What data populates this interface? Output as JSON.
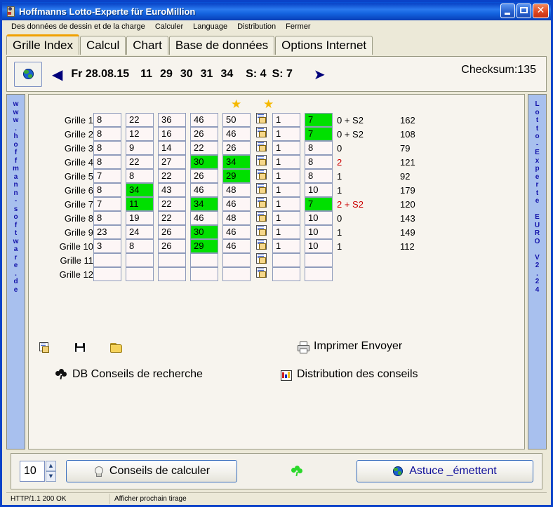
{
  "window": {
    "title": "Hoffmanns Lotto-Experte  für EuroMillion",
    "icon": "app-icon",
    "minimize": "_",
    "maximize": "□",
    "close": "✕"
  },
  "menu": {
    "items": [
      "Des données de dessin et de la charge",
      "Calculer",
      "Language",
      "Distribution",
      "Fermer"
    ]
  },
  "tabs": [
    {
      "label": "Grille Index",
      "active": true
    },
    {
      "label": "Calcul",
      "active": false
    },
    {
      "label": "Chart",
      "active": false
    },
    {
      "label": "Base de données",
      "active": false
    },
    {
      "label": "Options Internet",
      "active": false
    }
  ],
  "drawbar": {
    "globe_icon": "globe-icon",
    "prev_arrow": "◀",
    "next_arrow": "➤",
    "date": "Fr 28.08.15",
    "numbers": [
      "11",
      "29",
      "30",
      "31",
      "34"
    ],
    "star_labels": [
      "S: 4",
      "S: 7"
    ],
    "checksum": "Checksum:135"
  },
  "left_banner": "www.hoffmann-software.de",
  "right_banner": "Lotto-Experte EURO V2.24",
  "grid": {
    "star_markers": [
      "★",
      "★"
    ],
    "rows": [
      {
        "label": "Grille 1",
        "nums": [
          "8",
          "22",
          "36",
          "46",
          "50"
        ],
        "hits": [
          false,
          false,
          false,
          false,
          false
        ],
        "stars": [
          "1",
          "7"
        ],
        "star_hits": [
          false,
          true
        ],
        "result": "0 + S2",
        "result_warn": false,
        "sum": "162"
      },
      {
        "label": "Grille 2",
        "nums": [
          "8",
          "12",
          "16",
          "26",
          "46"
        ],
        "hits": [
          false,
          false,
          false,
          false,
          false
        ],
        "stars": [
          "1",
          "7"
        ],
        "star_hits": [
          false,
          true
        ],
        "result": "0 + S2",
        "result_warn": false,
        "sum": "108"
      },
      {
        "label": "Grille 3",
        "nums": [
          "8",
          "9",
          "14",
          "22",
          "26"
        ],
        "hits": [
          false,
          false,
          false,
          false,
          false
        ],
        "stars": [
          "1",
          "8"
        ],
        "star_hits": [
          false,
          false
        ],
        "result": "0",
        "result_warn": false,
        "sum": "79"
      },
      {
        "label": "Grille 4",
        "nums": [
          "8",
          "22",
          "27",
          "30",
          "34"
        ],
        "hits": [
          false,
          false,
          false,
          true,
          true
        ],
        "stars": [
          "1",
          "8"
        ],
        "star_hits": [
          false,
          false
        ],
        "result": "2",
        "result_warn": true,
        "sum": "121"
      },
      {
        "label": "Grille 5",
        "nums": [
          "7",
          "8",
          "22",
          "26",
          "29"
        ],
        "hits": [
          false,
          false,
          false,
          false,
          true
        ],
        "stars": [
          "1",
          "8"
        ],
        "star_hits": [
          false,
          false
        ],
        "result": "1",
        "result_warn": false,
        "sum": "92"
      },
      {
        "label": "Grille 6",
        "nums": [
          "8",
          "34",
          "43",
          "46",
          "48"
        ],
        "hits": [
          false,
          true,
          false,
          false,
          false
        ],
        "stars": [
          "1",
          "10"
        ],
        "star_hits": [
          false,
          false
        ],
        "result": "1",
        "result_warn": false,
        "sum": "179"
      },
      {
        "label": "Grille 7",
        "nums": [
          "7",
          "11",
          "22",
          "34",
          "46"
        ],
        "hits": [
          false,
          true,
          false,
          true,
          false
        ],
        "stars": [
          "1",
          "7"
        ],
        "star_hits": [
          false,
          true
        ],
        "result": "2 + S2",
        "result_warn": true,
        "sum": "120"
      },
      {
        "label": "Grille 8",
        "nums": [
          "8",
          "19",
          "22",
          "46",
          "48"
        ],
        "hits": [
          false,
          false,
          false,
          false,
          false
        ],
        "stars": [
          "1",
          "10"
        ],
        "star_hits": [
          false,
          false
        ],
        "result": "0",
        "result_warn": false,
        "sum": "143"
      },
      {
        "label": "Grille 9",
        "nums": [
          "23",
          "24",
          "26",
          "30",
          "46"
        ],
        "hits": [
          false,
          false,
          false,
          true,
          false
        ],
        "stars": [
          "1",
          "10"
        ],
        "star_hits": [
          false,
          false
        ],
        "result": "1",
        "result_warn": false,
        "sum": "149"
      },
      {
        "label": "Grille 10",
        "nums": [
          "3",
          "8",
          "26",
          "29",
          "46"
        ],
        "hits": [
          false,
          false,
          false,
          true,
          false
        ],
        "stars": [
          "1",
          "10"
        ],
        "star_hits": [
          false,
          false
        ],
        "result": "1",
        "result_warn": false,
        "sum": "112"
      },
      {
        "label": "Grille 11",
        "nums": [
          "",
          "",
          "",
          "",
          ""
        ],
        "hits": [
          false,
          false,
          false,
          false,
          false
        ],
        "stars": [
          "",
          ""
        ],
        "star_hits": [
          false,
          false
        ],
        "result": "",
        "result_warn": false,
        "sum": ""
      },
      {
        "label": "Grille 12",
        "nums": [
          "",
          "",
          "",
          "",
          ""
        ],
        "hits": [
          false,
          false,
          false,
          false,
          false
        ],
        "stars": [
          "",
          ""
        ],
        "star_hits": [
          false,
          false
        ],
        "result": "",
        "result_warn": false,
        "sum": ""
      }
    ]
  },
  "actions": {
    "edit_icon": "edit-icon",
    "save_icon": "save-icon",
    "open_icon": "open-folder-icon",
    "print_label": "Imprimer Envoyer",
    "print_icon": "printer-icon",
    "db_search_label": "DB Conseils de recherche",
    "db_search_icon": "clover-icon",
    "distribution_label": "Distribution des conseils",
    "distribution_icon": "chart-icon"
  },
  "bottom": {
    "count_value": "10",
    "spin_up": "▲",
    "spin_down": "▼",
    "calc_label": "Conseils de calculer",
    "calc_icon": "bulb-icon",
    "clover_icon": "clover-icon",
    "send_label": "Astuce _émettent",
    "send_icon": "globe-icon"
  },
  "statusbar": {
    "http": "HTTP/1.1 200 OK",
    "hint": "Afficher prochain tirage"
  },
  "colors": {
    "hit_green": "#00e000",
    "warn_red": "#cc0000",
    "banner_blue": "#a8c0ee",
    "banner_text": "#1414aa",
    "star_gold": "#f5b800",
    "title_blue": "#0a46c8"
  }
}
